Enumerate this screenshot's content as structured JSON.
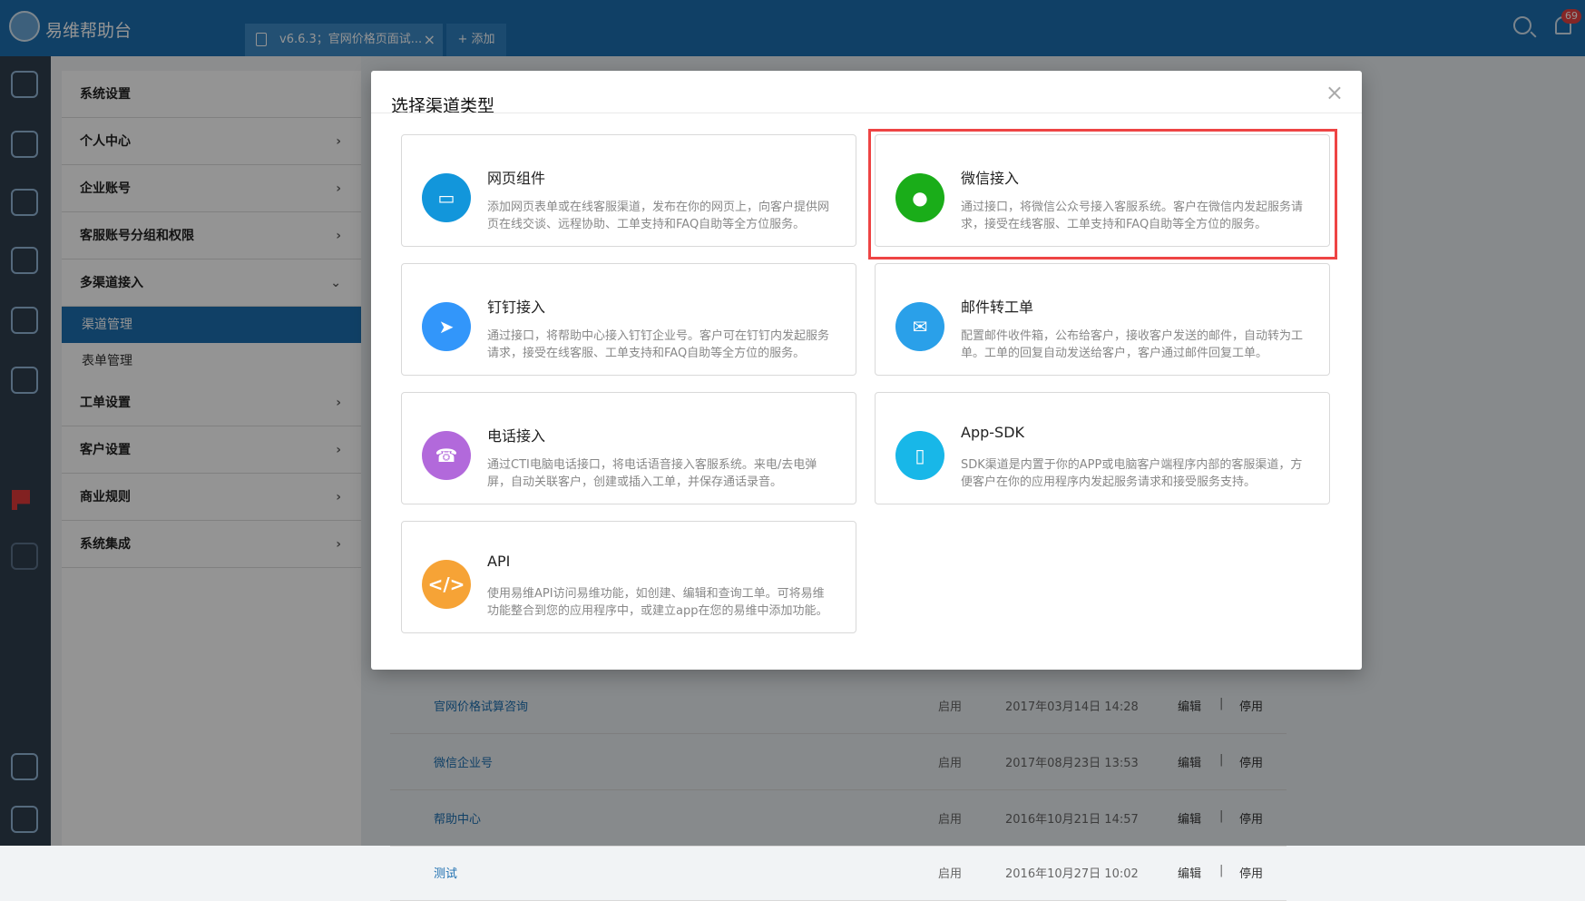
{
  "app": {
    "title": "易维帮助台"
  },
  "tabs": [
    {
      "label": "v6.6.3；官网价格页面试..."
    }
  ],
  "actions": {
    "add": "+ 添加",
    "notification_count": "69"
  },
  "sidebar": {
    "system_settings": "系统设置",
    "items": [
      {
        "label": "个人中心"
      },
      {
        "label": "企业账号"
      },
      {
        "label": "客服账号分组和权限"
      },
      {
        "label": "多渠道接入"
      },
      {
        "label": "工单设置"
      },
      {
        "label": "客户设置"
      },
      {
        "label": "商业规则"
      },
      {
        "label": "系统集成"
      }
    ],
    "subitems": [
      {
        "label": "渠道管理"
      },
      {
        "label": "表单管理"
      }
    ]
  },
  "modal": {
    "title": "选择渠道类型",
    "cards": [
      {
        "title": "网页组件",
        "desc": "添加网页表单或在线客服渠道，发布在你的网页上，向客户提供网页在线交谈、远程协助、工单支持和FAQ自助等全方位服务。",
        "icon": "monitor-icon",
        "color": "#1296db"
      },
      {
        "title": "微信接入",
        "desc": "通过接口，将微信公众号接入客服系统。客户在微信内发起服务请求，接受在线客服、工单支持和FAQ自助等全方位的服务。",
        "icon": "wechat-icon",
        "color": "#1aad19"
      },
      {
        "title": "钉钉接入",
        "desc": "通过接口，将帮助中心接入钉钉企业号。客户可在钉钉内发起服务请求，接受在线客服、工单支持和FAQ自助等全方位的服务。",
        "icon": "dingtalk-icon",
        "color": "#3296fa"
      },
      {
        "title": "邮件转工单",
        "desc": "配置邮件收件箱，公布给客户，接收客户发送的邮件，自动转为工单。工单的回复自动发送给客户，客户通过邮件回复工单。",
        "icon": "mail-icon",
        "color": "#2aa0e9"
      },
      {
        "title": "电话接入",
        "desc": "通过CTI电脑电话接口，将电话语音接入客服系统。来电/去电弹屏，自动关联客户，创建或插入工单，并保存通话录音。",
        "icon": "phone-icon",
        "color": "#b269db"
      },
      {
        "title": "App-SDK",
        "desc": "SDK渠道是内置于你的APP或电脑客户端程序内部的客服渠道，方便客户在你的应用程序内发起服务请求和接受服务支持。",
        "icon": "mobile-icon",
        "color": "#18b7e8"
      },
      {
        "title": "API",
        "desc": "使用易维API访问易维功能，如创建、编辑和查询工单。可将易维功能整合到您的应用程序中，或建立app在您的易维中添加功能。",
        "icon": "code-icon",
        "color": "#f6a336"
      }
    ]
  },
  "rows": [
    {
      "name": "官网价格试算咨询",
      "status": "启用",
      "date": "2017年03月14日 14:28",
      "edit": "编辑",
      "separator": "|",
      "stop": "停用",
      "icon_color": "#1296db"
    },
    {
      "name": "微信企业号",
      "status": "启用",
      "date": "2017年08月23日 13:53",
      "edit": "编辑",
      "separator": "|",
      "stop": "停用",
      "icon_color": "#1aad19"
    },
    {
      "name": "帮助中心",
      "status": "启用",
      "date": "2016年10月21日 14:57",
      "edit": "编辑",
      "separator": "|",
      "stop": "停用",
      "icon_color": "#3296fa"
    },
    {
      "name": "测试",
      "status": "启用",
      "date": "2016年10月27日 10:02",
      "edit": "编辑",
      "separator": "|",
      "stop": "停用",
      "icon_color": "#f6a336"
    }
  ]
}
